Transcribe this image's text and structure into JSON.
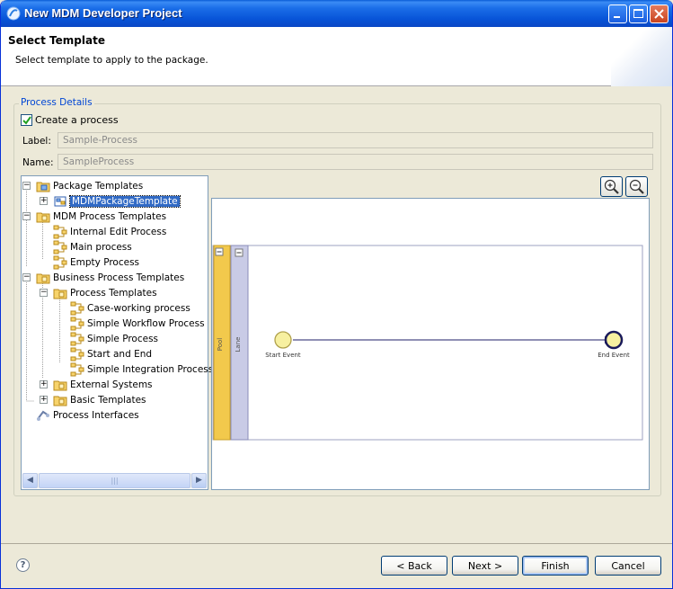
{
  "window": {
    "title": "New MDM Developer Project"
  },
  "header": {
    "title": "Select Template",
    "description": "Select template to apply to the package."
  },
  "group": {
    "legend": "Process Details"
  },
  "create_process": {
    "label": "Create a process",
    "checked": true
  },
  "fields": {
    "label_caption": "Label:",
    "label_value": "Sample-Process",
    "name_caption": "Name:",
    "name_value": "SampleProcess"
  },
  "tree": {
    "items": [
      {
        "label": "Package Templates",
        "icon": "package-folder-icon",
        "expander": "minus"
      },
      {
        "label": "MDMPackageTemplate",
        "icon": "package-icon",
        "expander": "plus",
        "selected": true
      },
      {
        "label": "MDM Process Templates",
        "icon": "folder-icon",
        "expander": "minus"
      },
      {
        "label": "Internal Edit Process",
        "icon": "process-icon"
      },
      {
        "label": "Main process",
        "icon": "process-icon"
      },
      {
        "label": "Empty Process",
        "icon": "process-icon"
      },
      {
        "label": "Business Process Templates",
        "icon": "folder-icon",
        "expander": "minus"
      },
      {
        "label": "Process Templates",
        "icon": "folder-icon",
        "expander": "minus"
      },
      {
        "label": "Case-working process",
        "icon": "process-icon"
      },
      {
        "label": "Simple Workflow Process",
        "icon": "process-icon"
      },
      {
        "label": "Simple Process",
        "icon": "process-icon"
      },
      {
        "label": "Start and End",
        "icon": "process-icon"
      },
      {
        "label": "Simple Integration Process",
        "icon": "process-icon"
      },
      {
        "label": "External Systems",
        "icon": "folder-icon",
        "expander": "plus"
      },
      {
        "label": "Basic Templates",
        "icon": "folder-icon",
        "expander": "plus"
      },
      {
        "label": "Process Interfaces",
        "icon": "interfaces-icon"
      }
    ]
  },
  "diagram": {
    "pool_label": "Pool",
    "lane_label": "Lane",
    "start_event_label": "Start Event",
    "end_event_label": "End Event",
    "pool_color": "#f2c94c",
    "lane_color": "#c9cbe6"
  },
  "buttons": {
    "back": "< Back",
    "next": "Next >",
    "finish": "Finish",
    "cancel": "Cancel",
    "help": "?"
  }
}
